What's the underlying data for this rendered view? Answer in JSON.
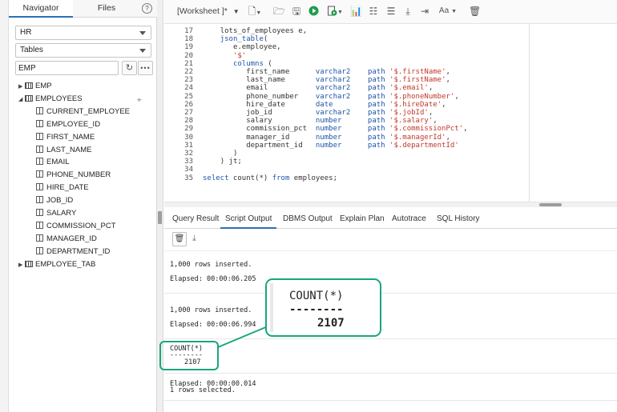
{
  "navigator": {
    "tabs": [
      {
        "label": "Navigator"
      },
      {
        "label": "Files"
      }
    ],
    "help_icon": "help-circle-icon",
    "schema": "HR",
    "object_type": "Tables",
    "filter_value": "EMP",
    "tree": [
      {
        "label": "EMP",
        "expanded": false,
        "kind": "table"
      },
      {
        "label": "EMPLOYEES",
        "expanded": true,
        "kind": "table"
      },
      {
        "label": "CURRENT_EMPLOYEE",
        "kind": "column"
      },
      {
        "label": "EMPLOYEE_ID",
        "kind": "column"
      },
      {
        "label": "FIRST_NAME",
        "kind": "column"
      },
      {
        "label": "LAST_NAME",
        "kind": "column"
      },
      {
        "label": "EMAIL",
        "kind": "column"
      },
      {
        "label": "PHONE_NUMBER",
        "kind": "column"
      },
      {
        "label": "HIRE_DATE",
        "kind": "column"
      },
      {
        "label": "JOB_ID",
        "kind": "column"
      },
      {
        "label": "SALARY",
        "kind": "column"
      },
      {
        "label": "COMMISSION_PCT",
        "kind": "column"
      },
      {
        "label": "MANAGER_ID",
        "kind": "column"
      },
      {
        "label": "DEPARTMENT_ID",
        "kind": "column"
      },
      {
        "label": "EMPLOYEE_TAB",
        "expanded": false,
        "kind": "table"
      }
    ]
  },
  "toolbar": {
    "worksheet_tab": "[Worksheet ]*",
    "font_button": "Aa"
  },
  "editor": {
    "lines": [
      {
        "no": "17",
        "indent": "    ",
        "parts": [
          [
            "t",
            "lots_of_employees e,"
          ]
        ]
      },
      {
        "no": "18",
        "indent": "    ",
        "parts": [
          [
            "k",
            "json_table"
          ],
          [
            "t",
            "("
          ]
        ]
      },
      {
        "no": "19",
        "indent": "       ",
        "parts": [
          [
            "t",
            "e.employee,"
          ]
        ]
      },
      {
        "no": "20",
        "indent": "       ",
        "parts": [
          [
            "s",
            "'$'"
          ]
        ]
      },
      {
        "no": "21",
        "indent": "       ",
        "parts": [
          [
            "k",
            "columns"
          ],
          [
            "t",
            " ("
          ]
        ]
      },
      {
        "no": "22",
        "indent": "          ",
        "parts": [
          [
            "t",
            "first_name      "
          ],
          [
            "k",
            "varchar2"
          ],
          [
            "t",
            "    "
          ],
          [
            "k",
            "path"
          ],
          [
            "t",
            " "
          ],
          [
            "s",
            "'$.firstName'"
          ],
          [
            "t",
            ","
          ]
        ]
      },
      {
        "no": "23",
        "indent": "          ",
        "parts": [
          [
            "t",
            "last_name       "
          ],
          [
            "k",
            "varchar2"
          ],
          [
            "t",
            "    "
          ],
          [
            "k",
            "path"
          ],
          [
            "t",
            " "
          ],
          [
            "s",
            "'$.firstName'"
          ],
          [
            "t",
            ","
          ]
        ]
      },
      {
        "no": "24",
        "indent": "          ",
        "parts": [
          [
            "t",
            "email           "
          ],
          [
            "k",
            "varchar2"
          ],
          [
            "t",
            "    "
          ],
          [
            "k",
            "path"
          ],
          [
            "t",
            " "
          ],
          [
            "s",
            "'$.email'"
          ],
          [
            "t",
            ","
          ]
        ]
      },
      {
        "no": "25",
        "indent": "          ",
        "parts": [
          [
            "t",
            "phone_number    "
          ],
          [
            "k",
            "varchar2"
          ],
          [
            "t",
            "    "
          ],
          [
            "k",
            "path"
          ],
          [
            "t",
            " "
          ],
          [
            "s",
            "'$.phoneNumber'"
          ],
          [
            "t",
            ","
          ]
        ]
      },
      {
        "no": "26",
        "indent": "          ",
        "parts": [
          [
            "t",
            "hire_date       "
          ],
          [
            "k",
            "date"
          ],
          [
            "t",
            "        "
          ],
          [
            "k",
            "path"
          ],
          [
            "t",
            " "
          ],
          [
            "s",
            "'$.hireDate'"
          ],
          [
            "t",
            ","
          ]
        ]
      },
      {
        "no": "27",
        "indent": "          ",
        "parts": [
          [
            "t",
            "job_id          "
          ],
          [
            "k",
            "varchar2"
          ],
          [
            "t",
            "    "
          ],
          [
            "k",
            "path"
          ],
          [
            "t",
            " "
          ],
          [
            "s",
            "'$.jobId'"
          ],
          [
            "t",
            ","
          ]
        ]
      },
      {
        "no": "28",
        "indent": "          ",
        "parts": [
          [
            "t",
            "salary          "
          ],
          [
            "k",
            "number"
          ],
          [
            "t",
            "      "
          ],
          [
            "k",
            "path"
          ],
          [
            "t",
            " "
          ],
          [
            "s",
            "'$.salary'"
          ],
          [
            "t",
            ","
          ]
        ]
      },
      {
        "no": "29",
        "indent": "          ",
        "parts": [
          [
            "t",
            "commission_pct  "
          ],
          [
            "k",
            "number"
          ],
          [
            "t",
            "      "
          ],
          [
            "k",
            "path"
          ],
          [
            "t",
            " "
          ],
          [
            "s",
            "'$.commissionPct'"
          ],
          [
            "t",
            ","
          ]
        ]
      },
      {
        "no": "30",
        "indent": "          ",
        "parts": [
          [
            "t",
            "manager_id      "
          ],
          [
            "k",
            "number"
          ],
          [
            "t",
            "      "
          ],
          [
            "k",
            "path"
          ],
          [
            "t",
            " "
          ],
          [
            "s",
            "'$.managerId'"
          ],
          [
            "t",
            ","
          ]
        ]
      },
      {
        "no": "31",
        "indent": "          ",
        "parts": [
          [
            "t",
            "department_id   "
          ],
          [
            "k",
            "number"
          ],
          [
            "t",
            "      "
          ],
          [
            "k",
            "path"
          ],
          [
            "t",
            " "
          ],
          [
            "s",
            "'$.departmentId'"
          ]
        ]
      },
      {
        "no": "32",
        "indent": "       ",
        "parts": [
          [
            "t",
            ")"
          ]
        ]
      },
      {
        "no": "33",
        "indent": "    ",
        "parts": [
          [
            "t",
            ") jt;"
          ]
        ]
      },
      {
        "no": "34",
        "indent": "",
        "parts": []
      },
      {
        "no": "35",
        "indent": "",
        "parts": [
          [
            "k",
            "select"
          ],
          [
            "t",
            " count(*) "
          ],
          [
            "k",
            "from"
          ],
          [
            "t",
            " employees;"
          ]
        ]
      }
    ]
  },
  "results": {
    "tabs": [
      {
        "label": "Query Result"
      },
      {
        "label": "Script Output"
      },
      {
        "label": "DBMS Output"
      },
      {
        "label": "Explain Plan"
      },
      {
        "label": "Autotrace"
      },
      {
        "label": "SQL History"
      }
    ],
    "output": {
      "block1_rows": "1,000 rows inserted.",
      "block1_elapsed": "Elapsed: 00:00:06.205",
      "block2_rows": "1,000 rows inserted.",
      "block2_elapsed": "Elapsed: 00:00:06.994",
      "count_header": "COUNT(*)",
      "count_sep": "--------",
      "count_value": "2107",
      "block3_elapsed": "Elapsed: 00:00:00.014",
      "block3_rows": "1 rows selected."
    }
  },
  "callout": {
    "header": "COUNT(*)",
    "sep": "--------",
    "value": "2107",
    "accent": "#1aa57f"
  }
}
